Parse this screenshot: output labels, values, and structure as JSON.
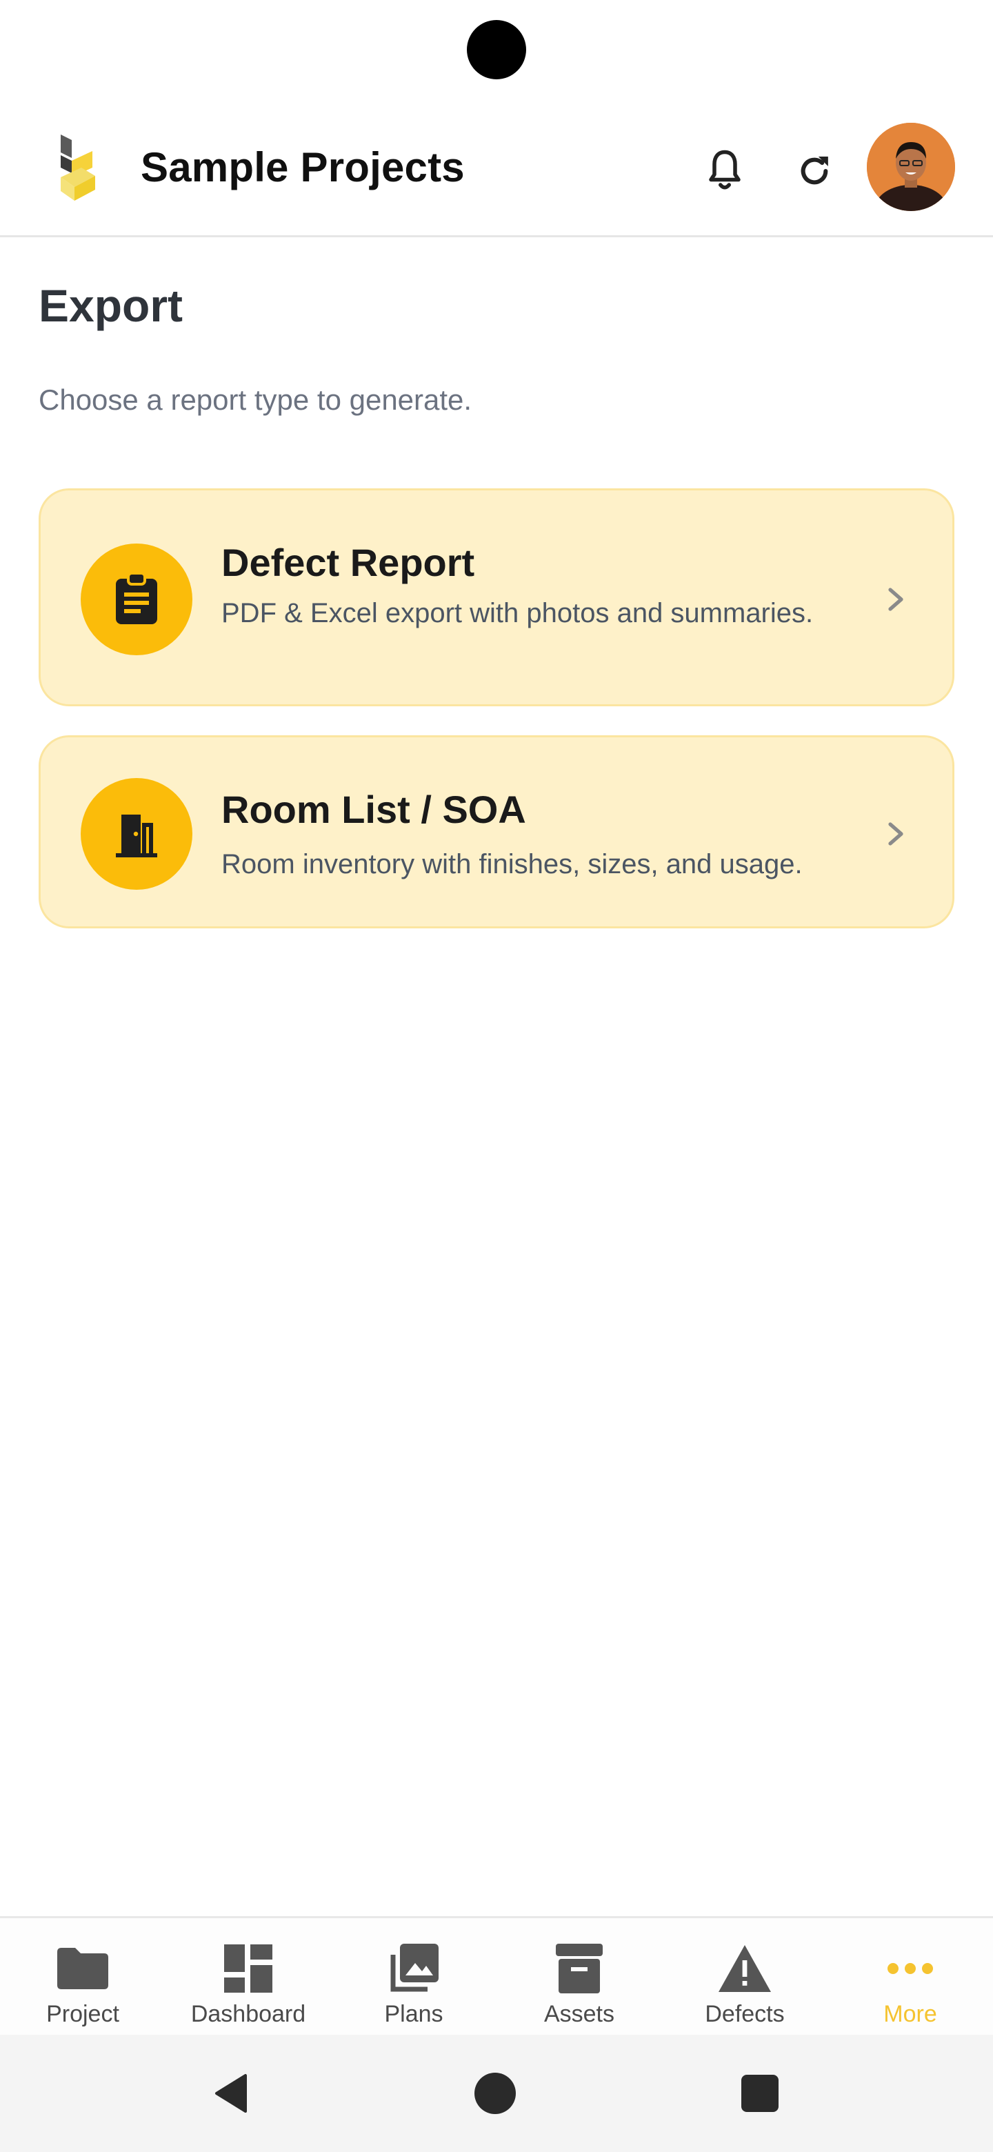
{
  "header": {
    "title": "Sample Projects",
    "icons": [
      "app-logo",
      "bell-icon",
      "refresh-icon",
      "user-avatar"
    ]
  },
  "page": {
    "title": "Export",
    "subtitle": "Choose a report type to generate."
  },
  "reports": [
    {
      "title": "Defect Report",
      "description": "PDF & Excel export with photos and summaries.",
      "icon": "clipboard-icon"
    },
    {
      "title": "Room List / SOA",
      "description": "Room inventory with finishes, sizes, and usage.",
      "icon": "door-icon"
    }
  ],
  "nav": {
    "items": [
      {
        "label": "Project",
        "icon": "folder-icon"
      },
      {
        "label": "Dashboard",
        "icon": "dashboard-icon"
      },
      {
        "label": "Plans",
        "icon": "images-icon"
      },
      {
        "label": "Assets",
        "icon": "archive-icon"
      },
      {
        "label": "Defects",
        "icon": "warning-icon"
      },
      {
        "label": "More",
        "icon": "more-icon"
      }
    ],
    "active": "More"
  },
  "colors": {
    "accent": "#f5c330",
    "card_bg": "#fef1c9",
    "card_border": "#fbe5a0",
    "icon_circle": "#fbbc0a",
    "text_muted": "#6b7280"
  }
}
